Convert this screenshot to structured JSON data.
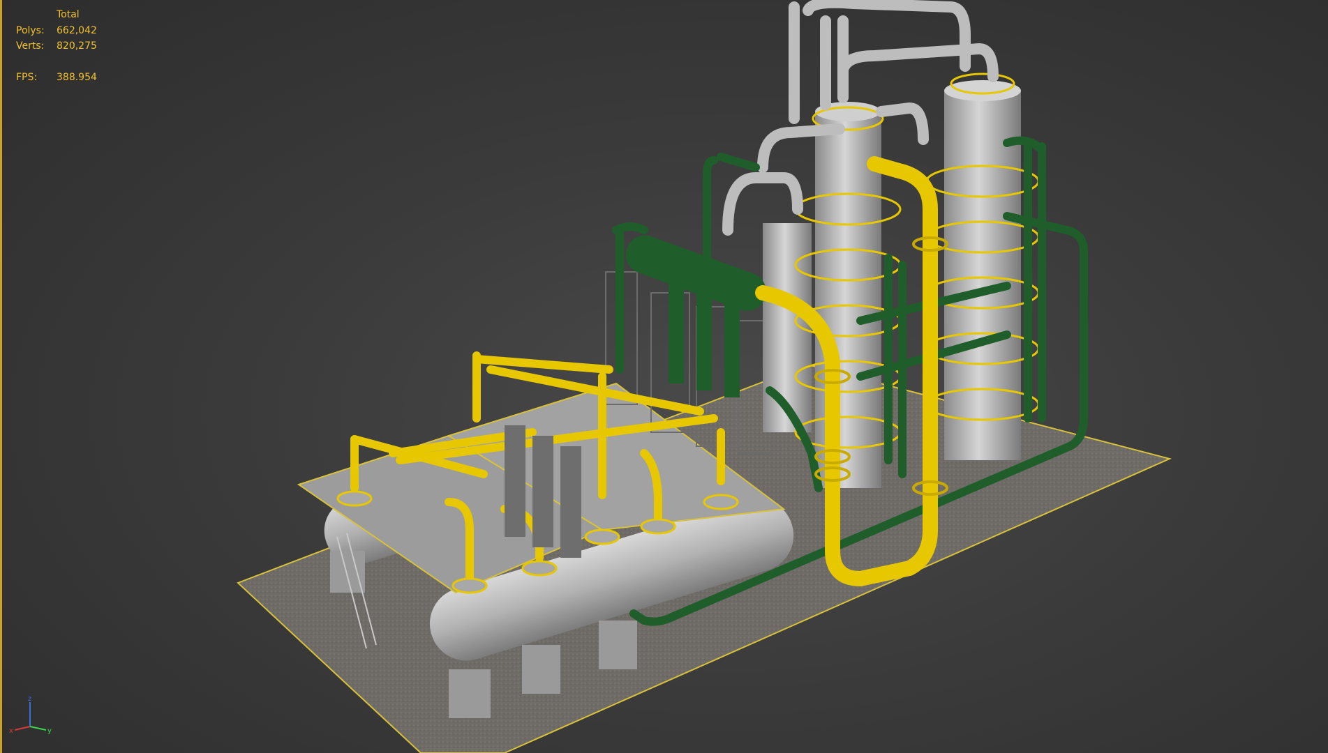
{
  "viewport": {
    "background_color": "#3b3b3b",
    "active_border_color": "#c9a227"
  },
  "stats": {
    "header": "Total",
    "polys_label": "Polys:",
    "polys_value": "662,042",
    "verts_label": "Verts:",
    "verts_value": "820,275",
    "fps_label": "FPS:",
    "fps_value": "388.954",
    "text_color": "#f2c12e"
  },
  "scene": {
    "subject": "industrial-plant-3d-model",
    "colors": {
      "pipe_yellow": "#e6c700",
      "pipe_green": "#1f5e2a",
      "steel_grey": "#b8b8b8",
      "ground_pad": "#6e6a66",
      "pad_outline": "#d8c23a"
    }
  },
  "axis_gizmo": {
    "z_label": "z",
    "x_label": "x",
    "y_label": "y",
    "icon": "axis-tripod-icon"
  }
}
